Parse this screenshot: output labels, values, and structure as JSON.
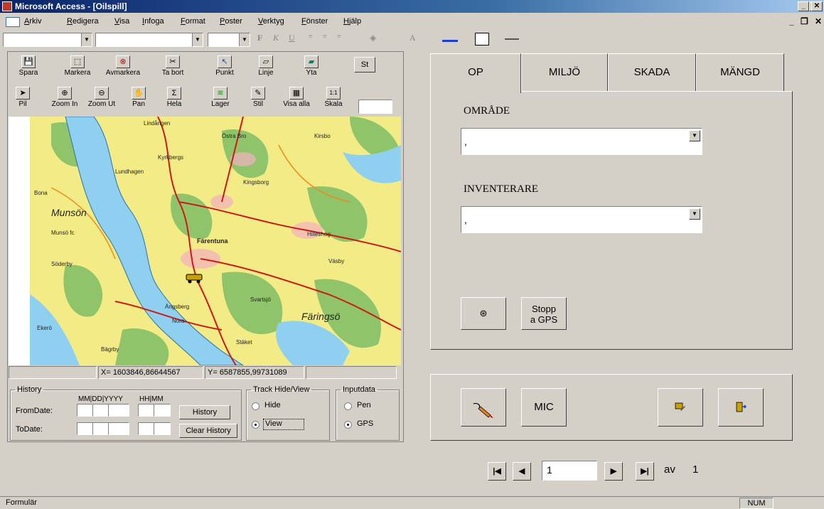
{
  "window": {
    "title": "Microsoft Access - [Oilspill]",
    "controls": [
      "_",
      "❐",
      "✕"
    ]
  },
  "menubar": {
    "items": [
      "Arkiv",
      "Redigera",
      "Visa",
      "Infoga",
      "Format",
      "Poster",
      "Verktyg",
      "Fönster",
      "Hjälp"
    ],
    "mdi_controls": [
      "_",
      "❐",
      "✕"
    ]
  },
  "fmt_toolbar": {
    "glyphs": [
      "F",
      "K",
      "U",
      "A"
    ]
  },
  "map_toolbar": {
    "row1": [
      {
        "label": "Spara",
        "icon": "💾"
      },
      {
        "label": "Markera",
        "icon": "⬚"
      },
      {
        "label": "Avmarkera",
        "icon": "⊗"
      },
      {
        "label": "Ta bort",
        "icon": "✂"
      },
      {
        "label": "Punkt",
        "icon": "↖"
      },
      {
        "label": "Linje",
        "icon": "▱"
      },
      {
        "label": "Yta",
        "icon": "▰"
      }
    ],
    "st_label": "St",
    "row2": [
      {
        "label": "Pil",
        "icon": "➤"
      },
      {
        "label": "Zoom In",
        "icon": "⊕"
      },
      {
        "label": "Zoom Ut",
        "icon": "⊖"
      },
      {
        "label": "Pan",
        "icon": "✋"
      },
      {
        "label": "Hela",
        "icon": "Σ"
      },
      {
        "label": "Lager",
        "icon": "≋"
      },
      {
        "label": "Stil",
        "icon": "✎"
      },
      {
        "label": "Visa alla",
        "icon": "▦"
      },
      {
        "label": "Skala",
        "icon": "1:1"
      }
    ]
  },
  "map": {
    "places": [
      "Lindången",
      "Östra Bro",
      "Kirsbo",
      "Kyrkbergs",
      "Kingsborg",
      "Bona",
      "Munsön",
      "Munsö fc",
      "Söderby",
      "Ekerö",
      "Färentuna",
      "Hilleshög",
      "Väsby",
      "Lundhagen",
      "Färingsö",
      "Nora",
      "Svartsjö",
      "Ängsberg",
      "Stäket",
      "Bägrby"
    ]
  },
  "coords": {
    "x": "X= 1603846,86644567",
    "y": "Y= 6587855,99731089"
  },
  "history": {
    "legend": "History",
    "date_header": "MM|DD|YYYY",
    "time_header": "HH|MM",
    "from_label": "FromDate:",
    "to_label": "ToDate:",
    "history_button": "History",
    "clear_button": "Clear History"
  },
  "track": {
    "legend": "Track Hide/View",
    "hide": "Hide",
    "view": "View",
    "selected": "View"
  },
  "inputdata": {
    "legend": "Inputdata",
    "pen": "Pen",
    "gps": "GPS",
    "selected": "GPS"
  },
  "tabs": [
    {
      "label": "OP",
      "active": true
    },
    {
      "label": "MILJÖ",
      "active": false
    },
    {
      "label": "SKADA",
      "active": false
    },
    {
      "label": "MÄNGD",
      "active": false
    }
  ],
  "op_form": {
    "omrade_label": "OMRÅDE",
    "omrade_value": ",",
    "inventerare_label": "INVENTERARE",
    "inventerare_value": ",",
    "gps_icon_glyph": "⊛",
    "stop_gps_line1": "Stopp",
    "stop_gps_line2": "a GPS"
  },
  "actions": {
    "mic_label": "MIC"
  },
  "record_nav": {
    "current": "1",
    "of_label": "av",
    "total": "1",
    "first": "⏮",
    "prev": "◀",
    "next": "▶",
    "last": "⏭"
  },
  "status": {
    "left": "Formulär",
    "num": "NUM"
  }
}
